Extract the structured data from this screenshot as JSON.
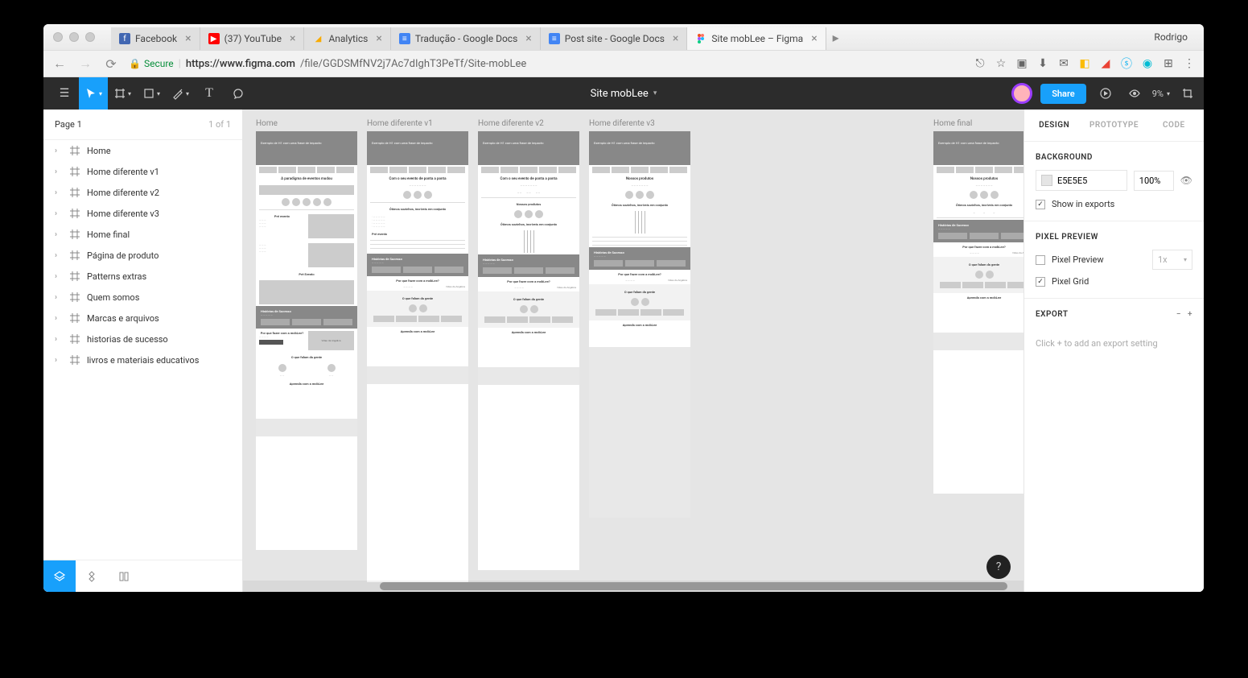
{
  "browser": {
    "profile": "Rodrigo",
    "tabs": [
      {
        "icon": "fb",
        "label": "Facebook"
      },
      {
        "icon": "yt",
        "label": "(37) YouTube"
      },
      {
        "icon": "ga",
        "label": "Analytics"
      },
      {
        "icon": "gd",
        "label": "Tradução - Google Docs"
      },
      {
        "icon": "gd",
        "label": "Post site - Google Docs"
      },
      {
        "icon": "fg",
        "label": "Site mobLee – Figma",
        "active": true
      }
    ],
    "secure_label": "Secure",
    "url_host": "https://www.figma.com",
    "url_path": "/file/GGDSMfNV2j7Ac7dIghT3PeTf/Site-mobLee"
  },
  "figma": {
    "doc_title": "Site mobLee",
    "share": "Share",
    "zoom": "9%",
    "pages": {
      "label": "Page 1",
      "count": "1 of 1"
    },
    "layers": [
      "Home",
      "Home diferente v1",
      "Home diferente v2",
      "Home diferente v3",
      "Home final",
      "Página de produto",
      "Patterns extras",
      "Quem somos",
      "Marcas e arquivos",
      "historias de sucesso",
      "livros e materiais educativos"
    ],
    "frames": [
      {
        "label": "Home"
      },
      {
        "label": "Home diferente v1"
      },
      {
        "label": "Home diferente v2"
      },
      {
        "label": "Home diferente v3"
      },
      {
        "label": "Home final"
      }
    ],
    "wf": {
      "hero1": "Exemplo de H1\ncom uma frase de impacto",
      "paradigma": "A paradigma de eventos mudou",
      "ponta": "Com o seu evento de ponta a ponta",
      "nossos": "Nossos produtos",
      "otimos": "Ótimos sozinhos, incríveis em conjunto",
      "preevento": "Pré evento",
      "historias": "Histórias de Sucesso",
      "porque": "Por que fazer com a mobLee?",
      "angelica": "Vídeo da Angélica",
      "falam": "O que falam da gente",
      "aprenda": "Aprenda com a mobLee"
    },
    "right": {
      "tabs": [
        "DESIGN",
        "PROTOTYPE",
        "CODE"
      ],
      "background": "BACKGROUND",
      "bg_hex": "E5E5E5",
      "bg_opacity": "100%",
      "show_exports": "Show in exports",
      "pixel_preview_title": "PIXEL PREVIEW",
      "pixel_preview": "Pixel Preview",
      "pixel_grid": "Pixel Grid",
      "scale": "1x",
      "export": "EXPORT",
      "export_hint": "Click + to add an export setting"
    }
  }
}
